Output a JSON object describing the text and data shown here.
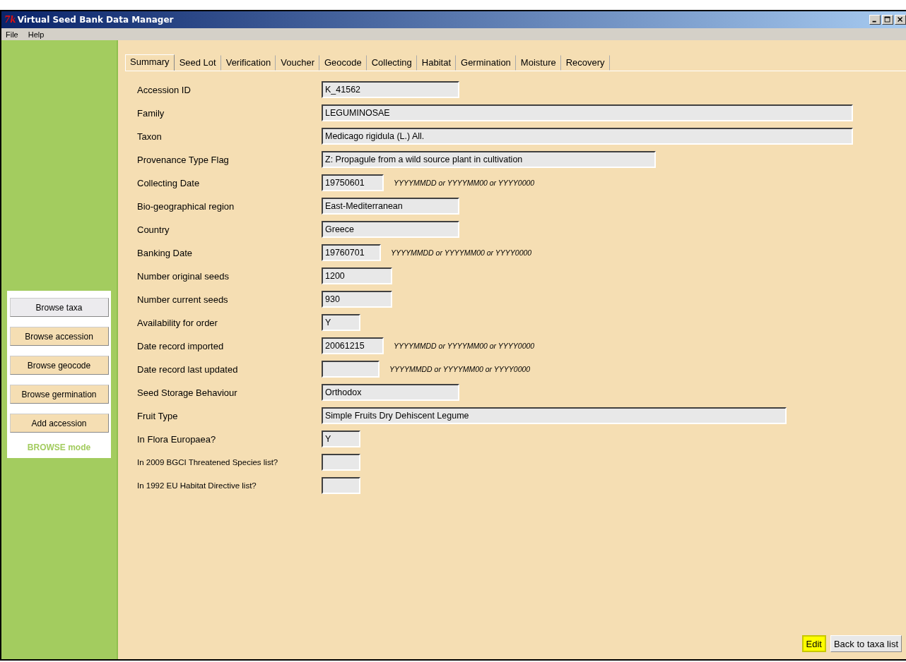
{
  "window": {
    "title": "Virtual Seed Bank Data Manager",
    "app_icon": "7k"
  },
  "menu": [
    "File",
    "Help"
  ],
  "tabs": [
    {
      "label": "Summary",
      "selected": true
    },
    {
      "label": "Seed Lot",
      "selected": false
    },
    {
      "label": "Verification",
      "selected": false
    },
    {
      "label": "Voucher",
      "selected": false
    },
    {
      "label": "Geocode",
      "selected": false
    },
    {
      "label": "Collecting",
      "selected": false
    },
    {
      "label": "Habitat",
      "selected": false
    },
    {
      "label": "Germination",
      "selected": false
    },
    {
      "label": "Moisture",
      "selected": false
    },
    {
      "label": "Recovery",
      "selected": false
    }
  ],
  "sidebar": {
    "buttons": [
      {
        "label": "Browse taxa",
        "selected": true
      },
      {
        "label": "Browse accession",
        "selected": false
      },
      {
        "label": "Browse geocode",
        "selected": false
      },
      {
        "label": "Browse germination",
        "selected": false
      },
      {
        "label": "Add accession",
        "selected": false
      }
    ],
    "mode": "BROWSE mode"
  },
  "fields": [
    {
      "label": "Accession ID",
      "value": "K_41562",
      "small_label": false
    },
    {
      "label": "Family",
      "value": "LEGUMINOSAE",
      "small_label": false
    },
    {
      "label": "Taxon",
      "value": "Medicago rigidula (L.) All.",
      "small_label": false
    },
    {
      "label": "Provenance Type Flag",
      "value": "Z: Propagule from a wild source plant in cultivation",
      "small_label": false
    },
    {
      "label": "Collecting Date",
      "value": "19750601",
      "hint": "YYYYMMDD or YYYYMM00 or YYYY0000",
      "small_label": false
    },
    {
      "label": "Bio-geographical region",
      "value": "East-Mediterranean",
      "small_label": false
    },
    {
      "label": "Country",
      "value": "Greece",
      "small_label": false
    },
    {
      "label": "Banking Date",
      "value": "19760701",
      "hint": "YYYYMMDD or YYYYMM00 or YYYY0000",
      "small_label": false
    },
    {
      "label": "Number original seeds",
      "value": "1200",
      "small_label": false
    },
    {
      "label": "Number current seeds",
      "value": "930",
      "small_label": false
    },
    {
      "label": "Availability for order",
      "value": "Y",
      "small_label": false
    },
    {
      "label": "Date record imported",
      "value": "20061215",
      "hint": "YYYYMMDD or YYYYMM00 or YYYY0000",
      "small_label": false
    },
    {
      "label": "Date record last updated",
      "hint": "YYYYMMDD or YYYYMM00 or YYYY0000",
      "small_label": false
    },
    {
      "label": "Seed Storage Behaviour",
      "value": "Orthodox",
      "small_label": false
    },
    {
      "label": "Fruit Type",
      "value": "Simple Fruits Dry Dehiscent Legume",
      "small_label": false
    },
    {
      "label": "In Flora Europaea?",
      "value": "Y",
      "small_label": false
    },
    {
      "label": "In 2009 BGCI Threatened Species list?",
      "small_label": true
    },
    {
      "label": "In 1992 EU Habitat Directive list?",
      "small_label": true
    }
  ],
  "actions": [
    {
      "label": "Edit",
      "kind": "highlight"
    },
    {
      "label": "Back to taxa list",
      "kind": "normal"
    }
  ]
}
